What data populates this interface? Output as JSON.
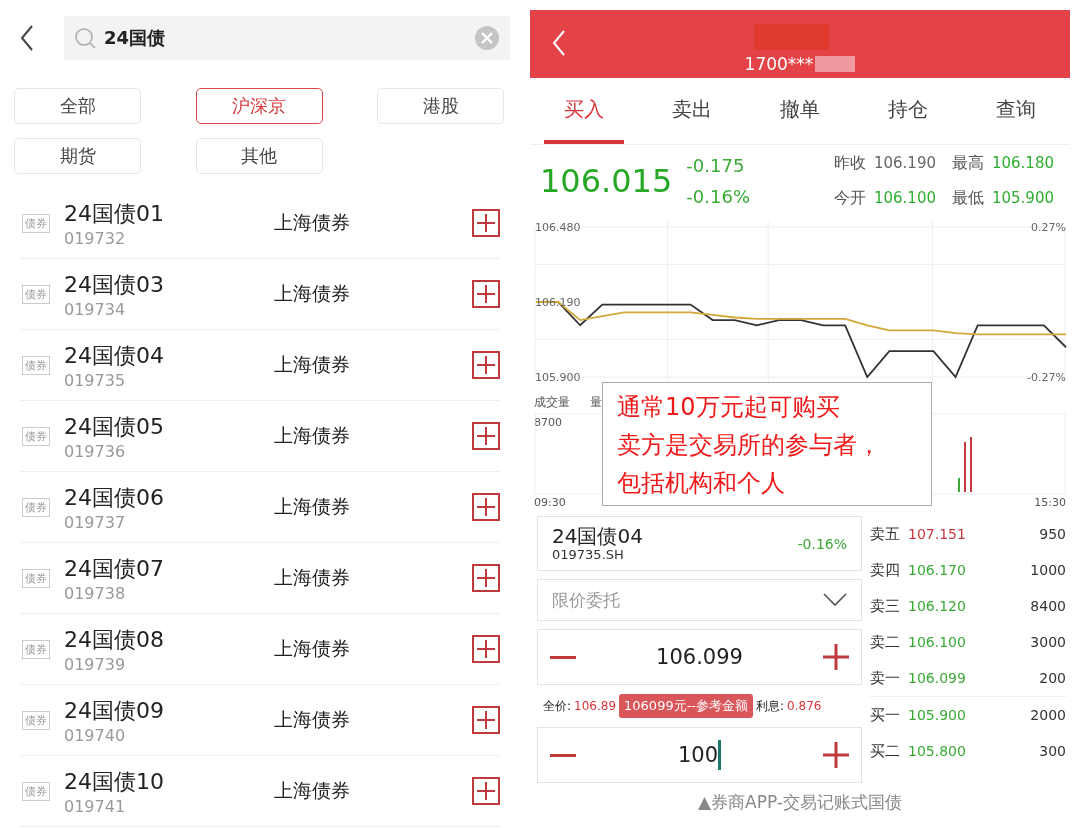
{
  "search_screen": {
    "search": {
      "value": "24国债"
    },
    "filters": [
      {
        "label": "全部",
        "selected": false
      },
      {
        "label": "沪深京",
        "selected": true
      },
      {
        "label": "港股",
        "selected": false
      },
      {
        "label": "期货",
        "selected": false
      },
      {
        "label": "其他",
        "selected": false
      }
    ],
    "results": [
      {
        "tag": "债券",
        "name": "24国债01",
        "code": "019732",
        "market": "上海债券"
      },
      {
        "tag": "债券",
        "name": "24国债03",
        "code": "019734",
        "market": "上海债券"
      },
      {
        "tag": "债券",
        "name": "24国债04",
        "code": "019735",
        "market": "上海债券"
      },
      {
        "tag": "债券",
        "name": "24国债05",
        "code": "019736",
        "market": "上海债券"
      },
      {
        "tag": "债券",
        "name": "24国债06",
        "code": "019737",
        "market": "上海债券"
      },
      {
        "tag": "债券",
        "name": "24国债07",
        "code": "019738",
        "market": "上海债券"
      },
      {
        "tag": "债券",
        "name": "24国债08",
        "code": "019739",
        "market": "上海债券"
      },
      {
        "tag": "债券",
        "name": "24国债09",
        "code": "019740",
        "market": "上海债券"
      },
      {
        "tag": "债券",
        "name": "24国债10",
        "code": "019741",
        "market": "上海债券"
      }
    ]
  },
  "trade_screen": {
    "header": {
      "account": "1700***"
    },
    "tabs": [
      {
        "label": "买入",
        "selected": true
      },
      {
        "label": "卖出",
        "selected": false
      },
      {
        "label": "撤单",
        "selected": false
      },
      {
        "label": "持仓",
        "selected": false
      },
      {
        "label": "查询",
        "selected": false
      }
    ],
    "quote": {
      "price": "106.015",
      "change": "-0.175",
      "change_pct": "-0.16%",
      "stats": [
        {
          "label": "昨收",
          "value": "106.190",
          "color": "#666666"
        },
        {
          "label": "最高",
          "value": "106.180",
          "color": "#2eae2e"
        },
        {
          "label": "今开",
          "value": "106.100",
          "color": "#2eae2e"
        },
        {
          "label": "最低",
          "value": "105.900",
          "color": "#2eae2e"
        }
      ]
    },
    "price_chart": {
      "right_labels": [
        "0.27%",
        "-0.27%"
      ],
      "chart_data": {
        "type": "line",
        "series": [
          {
            "color": "#333333",
            "values": [
              106.19,
              106.19,
              106.1,
              106.18,
              106.18,
              106.18,
              106.18,
              106.18,
              106.12,
              106.12,
              106.1,
              106.12,
              106.12,
              106.1,
              106.1,
              105.9,
              106.0,
              106.0,
              106.0,
              105.9,
              106.1,
              106.1,
              106.1,
              106.1,
              106.015
            ]
          },
          {
            "color": "#d4a838",
            "values": [
              106.19,
              106.19,
              106.12,
              106.135,
              106.15,
              106.15,
              106.15,
              106.15,
              106.14,
              106.13,
              106.125,
              106.125,
              106.125,
              106.125,
              106.125,
              106.1,
              106.08,
              106.08,
              106.08,
              106.07,
              106.065,
              106.065,
              106.065,
              106.065,
              106.065
            ]
          }
        ],
        "ylim": [
          105.9,
          106.48
        ],
        "yticks": [
          {
            "value": 106.48,
            "label": "106.480"
          },
          {
            "value": 106.19,
            "label": "106.190"
          },
          {
            "value": 105.9,
            "label": "105.900"
          }
        ]
      }
    },
    "volume_chart": {
      "title": "成交量",
      "legend": "量",
      "max": "8700",
      "start": "09:30",
      "end": "15:30"
    },
    "annotation": [
      "通常10万元起可购买",
      "卖方是交易所的参与者，",
      "包括机构和个人"
    ],
    "bond": {
      "name": "24国债04",
      "code": "019735.SH",
      "change_pct": "-0.16%"
    },
    "order_type": {
      "value": "限价委托"
    },
    "price_input": {
      "value": "106.099"
    },
    "full_price": {
      "label": "全价:",
      "value": "106.89",
      "interest_label": "利息:",
      "interest": "0.876"
    },
    "toast": "106099元--参考金额",
    "quantity_input": {
      "value": "100"
    },
    "order_book": [
      {
        "side": "卖五",
        "price": "107.151",
        "volume": "950",
        "color": "#c8393f"
      },
      {
        "side": "卖四",
        "price": "106.170",
        "volume": "1000",
        "color": "#3aaa35"
      },
      {
        "side": "卖三",
        "price": "106.120",
        "volume": "8400",
        "color": "#3aaa35"
      },
      {
        "side": "卖二",
        "price": "106.100",
        "volume": "3000",
        "color": "#3aaa35"
      },
      {
        "side": "卖一",
        "price": "106.099",
        "volume": "200",
        "color": "#3aaa35"
      },
      {
        "side": "买一",
        "price": "105.900",
        "volume": "2000",
        "color": "#3aaa35"
      },
      {
        "side": "买二",
        "price": "105.800",
        "volume": "300",
        "color": "#3aaa35"
      }
    ]
  },
  "caption": "▲券商APP-交易记账式国债"
}
